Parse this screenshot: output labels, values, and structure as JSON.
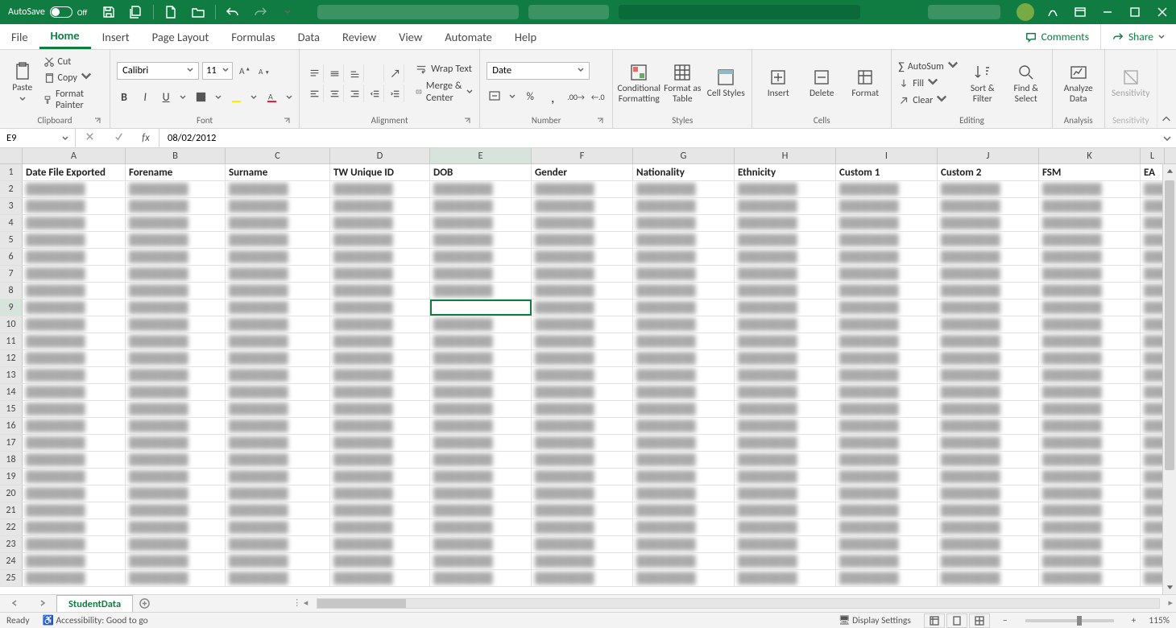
{
  "titlebar": {
    "autosave": "AutoSave",
    "autosave_state": "Off"
  },
  "menu": [
    "File",
    "Home",
    "Insert",
    "Page Layout",
    "Formulas",
    "Data",
    "Review",
    "View",
    "Automate",
    "Help"
  ],
  "comments_label": "Comments",
  "share_label": "Share",
  "ribbon": {
    "clipboard": {
      "label": "Clipboard",
      "paste": "Paste",
      "cut": "Cut",
      "copy": "Copy",
      "fp": "Format Painter"
    },
    "font": {
      "label": "Font",
      "name": "Calibri",
      "size": "11"
    },
    "alignment": {
      "label": "Alignment",
      "wrap": "Wrap Text",
      "merge": "Merge & Center"
    },
    "number": {
      "label": "Number",
      "format": "Date"
    },
    "styles": {
      "label": "Styles",
      "cond": "Conditional Formatting",
      "table": "Format as Table",
      "cell": "Cell Styles"
    },
    "cells": {
      "label": "Cells",
      "insert": "Insert",
      "delete": "Delete",
      "format": "Format"
    },
    "editing": {
      "label": "Editing",
      "autosum": "AutoSum",
      "fill": "Fill",
      "clear": "Clear",
      "sort": "Sort & Filter",
      "find": "Find & Select"
    },
    "analysis": {
      "label": "Analysis",
      "analyze": "Analyze Data"
    },
    "sensitivity": {
      "label": "Sensitivity",
      "btn": "Sensitivity"
    }
  },
  "namebox": "E9",
  "formula": "08/02/2012",
  "columns": [
    "A",
    "B",
    "C",
    "D",
    "E",
    "F",
    "G",
    "H",
    "I",
    "J",
    "K",
    "L"
  ],
  "selected_col_index": 4,
  "selected_row_index": 9,
  "headers": [
    "Date File Exported",
    "Forename",
    "Surname",
    "TW Unique ID",
    "DOB",
    "Gender",
    "Nationality",
    "Ethnicity",
    "Custom 1",
    "Custom 2",
    "FSM",
    "EA"
  ],
  "row_end": 25,
  "sheet_tab": "StudentData",
  "status": {
    "ready": "Ready",
    "acc": "Accessibility: Good to go",
    "display": "Display Settings",
    "zoom": "115%"
  },
  "blur_token": "████████"
}
